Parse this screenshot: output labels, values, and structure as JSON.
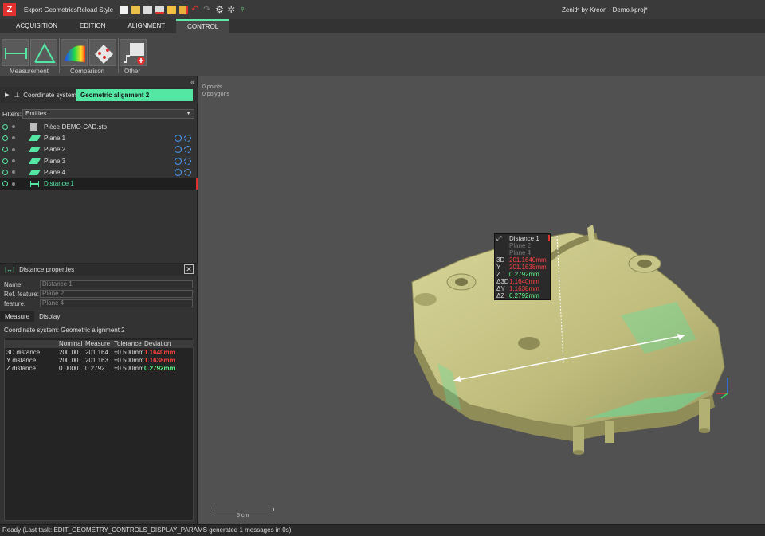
{
  "window": {
    "app_logo": "Z",
    "quick_access_text": "Export GeometriesReload Style",
    "title": "Zenith by Kreon - Demo.kproj*"
  },
  "tabs": [
    {
      "label": "ACQUISITION"
    },
    {
      "label": "EDITION"
    },
    {
      "label": "ALIGNMENT"
    },
    {
      "label": "CONTROL"
    }
  ],
  "ribbon": {
    "groups": [
      {
        "label": "Measurement"
      },
      {
        "label": "Comparison"
      },
      {
        "label": "Other"
      }
    ]
  },
  "coordinate_system": {
    "label": "Coordinate system:",
    "value": "Geometric alignment 2"
  },
  "filters": {
    "label": "Filters:",
    "value": "Entities"
  },
  "tree": {
    "items": [
      {
        "label": "Pièce-DEMO-CAD.stp",
        "icon": "cad-part-icon"
      },
      {
        "label": "Plane 1",
        "icon": "plane-icon"
      },
      {
        "label": "Plane 2",
        "icon": "plane-icon"
      },
      {
        "label": "Plane 3",
        "icon": "plane-icon"
      },
      {
        "label": "Plane 4",
        "icon": "plane-icon"
      },
      {
        "label": "Distance 1",
        "icon": "distance-icon"
      }
    ]
  },
  "properties": {
    "title": "Distance properties",
    "close": "✕",
    "fields": [
      {
        "label": "Name:",
        "value": "Distance 1"
      },
      {
        "label": "Ref. feature:",
        "value": "Plane 2"
      },
      {
        "label": "feature:",
        "value": "Plane 4"
      }
    ],
    "subtabs": [
      "Measure",
      "Display"
    ],
    "coord_system_line": "Coordinate system:  Geometric alignment 2",
    "table": {
      "headers": [
        "",
        "Nominal",
        "Measure",
        "Tolerance",
        "Deviation"
      ],
      "rows": [
        [
          "3D distance",
          "200.00...",
          "201.164...",
          "±0.500mm",
          "1.1640mm"
        ],
        [
          "Y distance",
          "200.00...",
          "201.163...",
          "±0.500mm",
          "1.1638mm"
        ],
        [
          "Z distance",
          "0.0000...",
          "0.2792...",
          "±0.500mm",
          "0.2792mm"
        ]
      ]
    }
  },
  "viewport": {
    "points": "0 points",
    "polygons": "0 polygons",
    "scale_label": "5 cm",
    "tooltip": {
      "title": "Distance 1",
      "ref": "Plane 2",
      "feature": "Plane 4",
      "rows": [
        {
          "key": "3D",
          "value": "201.1640mm"
        },
        {
          "key": "Y",
          "value": "201.1638mm"
        },
        {
          "key": "Z",
          "value": "0.2792mm"
        },
        {
          "key": "Δ3D",
          "value": "1.1640mm"
        },
        {
          "key": "ΔY",
          "value": "1.1638mm"
        },
        {
          "key": "ΔZ",
          "value": "0.2792mm"
        }
      ]
    }
  },
  "status": "Ready (Last task: EDIT_GEOMETRY_CONTROLS_DISPLAY_PARAMS generated 1 messages in 0s)",
  "colors": {
    "accent": "#54e6a3",
    "deviation_fail": "#ff4040",
    "deviation_ok": "#60ff90",
    "part": "#c7c486"
  }
}
